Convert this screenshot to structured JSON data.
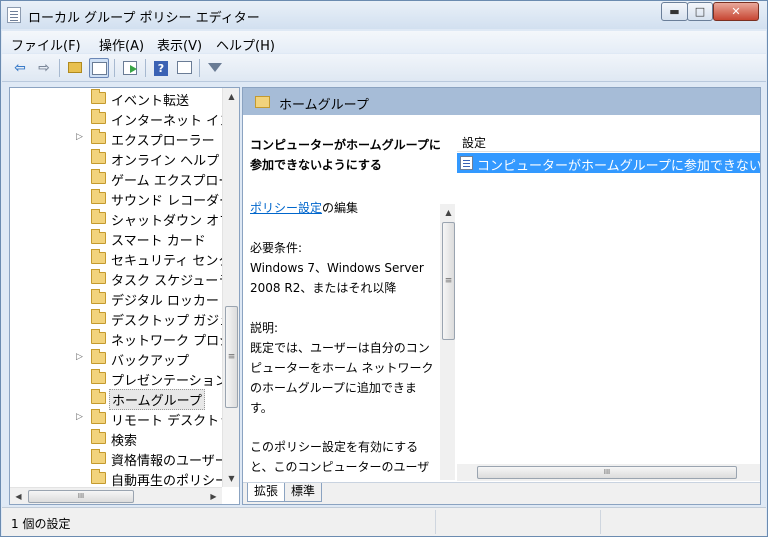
{
  "window": {
    "title": "ローカル グループ ポリシー エディター"
  },
  "window_controls": {
    "minimize": "▬",
    "maximize": "□",
    "close": "✕"
  },
  "menu": [
    "ファイル(F)",
    "操作(A)",
    "表示(V)",
    "ヘルプ(H)"
  ],
  "toolbar": {
    "back_icon": "arrow-left-icon",
    "forward_icon": "arrow-right-icon",
    "up_icon": "folder-up-icon",
    "show_hide_tree_icon": "console-tree-icon",
    "export_icon": "export-list-icon",
    "help_icon": "help-icon",
    "properties_icon": "properties-icon",
    "filter_icon": "filter-icon"
  },
  "tree": {
    "items": [
      {
        "label": "イベント転送",
        "expandable": false,
        "selected": false
      },
      {
        "label": "インターネット イン",
        "expandable": false,
        "selected": false
      },
      {
        "label": "エクスプローラー",
        "expandable": true,
        "selected": false
      },
      {
        "label": "オンライン ヘルプ",
        "expandable": false,
        "selected": false
      },
      {
        "label": "ゲーム エクスプロー",
        "expandable": false,
        "selected": false
      },
      {
        "label": "サウンド レコーダー",
        "expandable": false,
        "selected": false
      },
      {
        "label": "シャットダウン オプ",
        "expandable": false,
        "selected": false
      },
      {
        "label": "スマート カード",
        "expandable": false,
        "selected": false
      },
      {
        "label": "セキュリティ センタ",
        "expandable": false,
        "selected": false
      },
      {
        "label": "タスク スケジューラ",
        "expandable": false,
        "selected": false
      },
      {
        "label": "デジタル ロッカー",
        "expandable": false,
        "selected": false
      },
      {
        "label": "デスクトップ ガジェ",
        "expandable": false,
        "selected": false
      },
      {
        "label": "ネットワーク プロジ",
        "expandable": false,
        "selected": false
      },
      {
        "label": "バックアップ",
        "expandable": true,
        "selected": false
      },
      {
        "label": "プレゼンテーション",
        "expandable": false,
        "selected": false
      },
      {
        "label": "ホームグループ",
        "expandable": false,
        "selected": true
      },
      {
        "label": "リモート デスクトッ",
        "expandable": true,
        "selected": false
      },
      {
        "label": "検索",
        "expandable": false,
        "selected": false
      },
      {
        "label": "資格情報のユーザー",
        "expandable": false,
        "selected": false
      },
      {
        "label": "自動再生のポリシー",
        "expandable": false,
        "selected": false
      }
    ],
    "expander_glyph": "▷"
  },
  "scroll_glyphs": {
    "up": "▲",
    "down": "▼",
    "left": "◀",
    "right": "▶",
    "grip_v": "≡",
    "grip_h": "III"
  },
  "right_header": {
    "title": "ホームグループ"
  },
  "description": {
    "title_line1": "コンピューターがホームグループに",
    "title_line2": "参加できないようにする",
    "edit_link": "ポリシー設定",
    "edit_suffix": "の編集",
    "requirements_label": "必要条件:",
    "requirements_line1": "Windows 7、Windows Server",
    "requirements_line2": "2008 R2、またはそれ以降",
    "explanation_label": "説明:",
    "explanation_lines": [
      "既定では、ユーザーは自分のコン",
      "ピューターをホーム ネットワーク",
      "のホームグループに追加できま",
      "す。"
    ],
    "more_lines": [
      "このポリシー設定を有効にする",
      "と、このコンピューターのユーザ"
    ]
  },
  "settings": {
    "column_header": "設定",
    "rows": [
      "コンピューターがホームグループに参加できないようにする"
    ]
  },
  "tabs": [
    "拡張",
    "標準"
  ],
  "status": {
    "text": "1 個の設定"
  }
}
